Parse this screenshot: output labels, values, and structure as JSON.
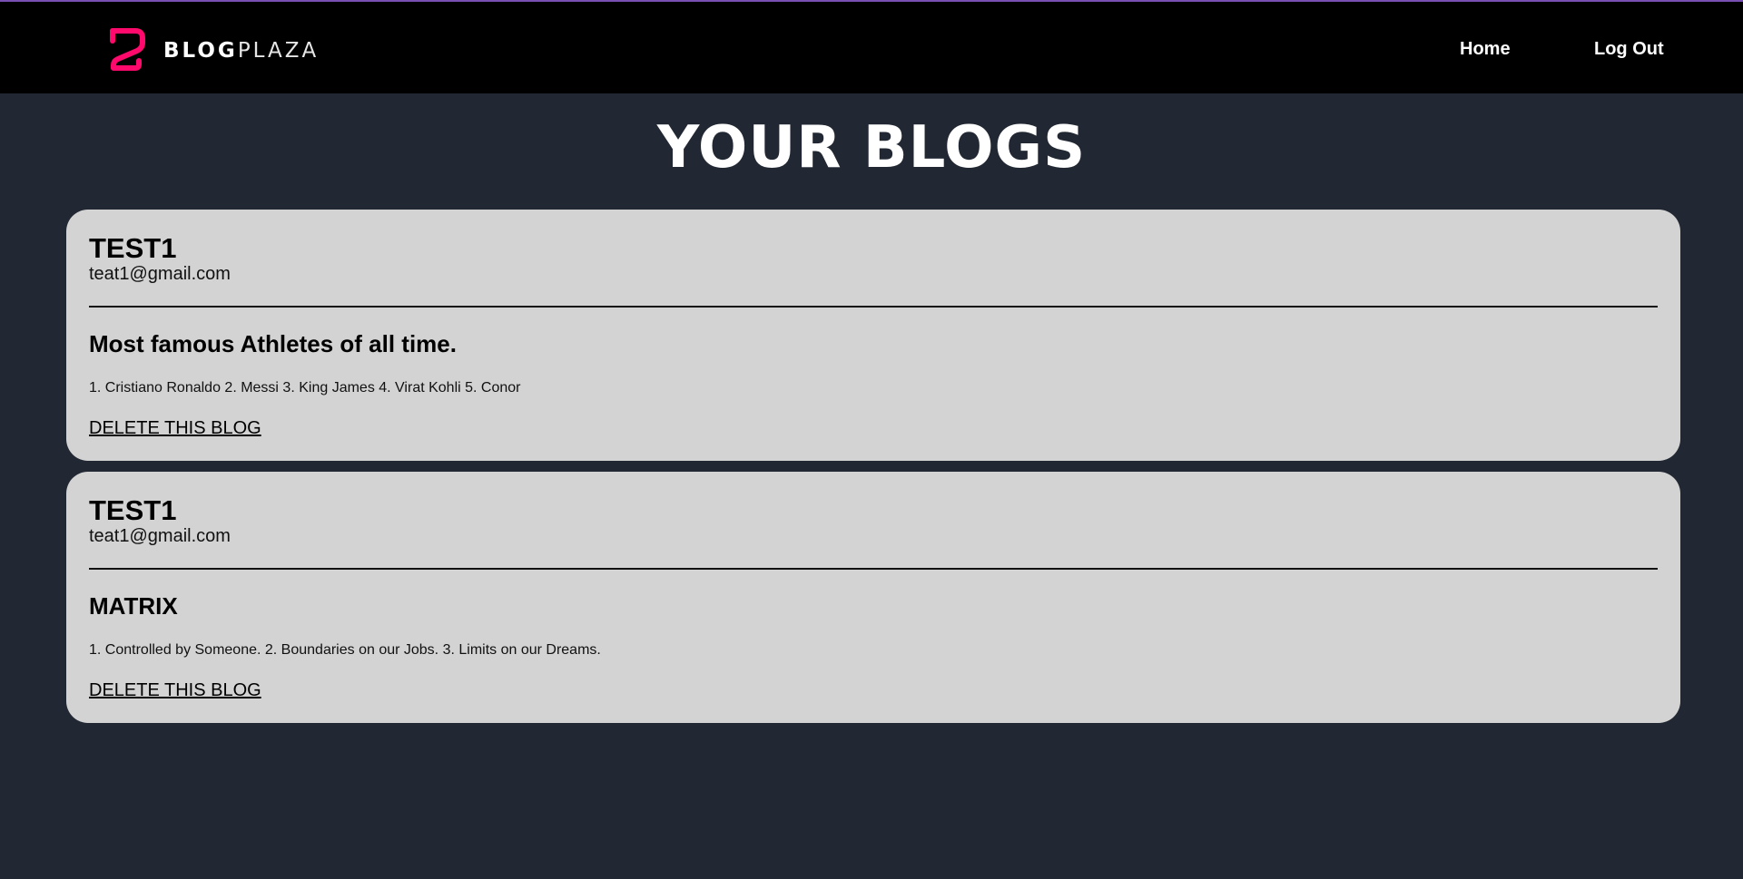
{
  "nav": {
    "brand_bold": "BLOG",
    "brand_light": "PLAZA",
    "home_label": "Home",
    "logout_label": "Log Out",
    "logo_color": "#ff0a6c"
  },
  "page": {
    "title": "YOUR BLOGS"
  },
  "blogs": [
    {
      "author": "TEST1",
      "email": "teat1@gmail.com",
      "title": "Most famous Athletes of all time.",
      "body": "1. Cristiano Ronaldo 2. Messi 3. King James 4. Virat Kohli 5. Conor",
      "delete_label": "DELETE THIS BLOG"
    },
    {
      "author": "TEST1",
      "email": "teat1@gmail.com",
      "title": "MATRIX",
      "body": "1. Controlled by Someone. 2. Boundaries on our Jobs. 3. Limits on our Dreams.",
      "delete_label": "DELETE THIS BLOG"
    }
  ]
}
